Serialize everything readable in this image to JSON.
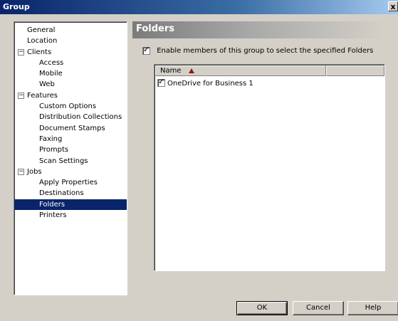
{
  "window": {
    "title": "Group",
    "close_label": "x"
  },
  "tree": {
    "items": [
      {
        "label": "General",
        "level": 0,
        "kind": "leaf"
      },
      {
        "label": "Location",
        "level": 0,
        "kind": "leaf"
      },
      {
        "label": "Clients",
        "level": 0,
        "kind": "group",
        "expander": "−"
      },
      {
        "label": "Access",
        "level": 1,
        "kind": "leaf"
      },
      {
        "label": "Mobile",
        "level": 1,
        "kind": "leaf"
      },
      {
        "label": "Web",
        "level": 1,
        "kind": "leaf"
      },
      {
        "label": "Features",
        "level": 0,
        "kind": "group",
        "expander": "−"
      },
      {
        "label": "Custom Options",
        "level": 1,
        "kind": "leaf"
      },
      {
        "label": "Distribution Collections",
        "level": 1,
        "kind": "leaf"
      },
      {
        "label": "Document Stamps",
        "level": 1,
        "kind": "leaf"
      },
      {
        "label": "Faxing",
        "level": 1,
        "kind": "leaf"
      },
      {
        "label": "Prompts",
        "level": 1,
        "kind": "leaf"
      },
      {
        "label": "Scan Settings",
        "level": 1,
        "kind": "leaf"
      },
      {
        "label": "Jobs",
        "level": 0,
        "kind": "group",
        "expander": "−"
      },
      {
        "label": "Apply Properties",
        "level": 1,
        "kind": "leaf"
      },
      {
        "label": "Destinations",
        "level": 1,
        "kind": "leaf"
      },
      {
        "label": "Folders",
        "level": 1,
        "kind": "leaf",
        "selected": true
      },
      {
        "label": "Printers",
        "level": 1,
        "kind": "leaf"
      }
    ]
  },
  "panel": {
    "title": "Folders",
    "enable_checkbox": {
      "label": "Enable members of this group to select the specified Folders",
      "checked": true,
      "mark": "✓"
    },
    "list": {
      "columns": [
        {
          "label": "Name",
          "sorted": "ascending"
        },
        {
          "label": ""
        }
      ],
      "rows": [
        {
          "label": "OneDrive for Business 1",
          "checked": true,
          "mark": "✓"
        }
      ]
    }
  },
  "buttons": {
    "ok": "OK",
    "cancel": "Cancel",
    "help": "Help"
  },
  "colors": {
    "selection": "#0a246a",
    "dialog_bg": "#d4d0c8",
    "sort_arrow": "#8b1a1a"
  }
}
